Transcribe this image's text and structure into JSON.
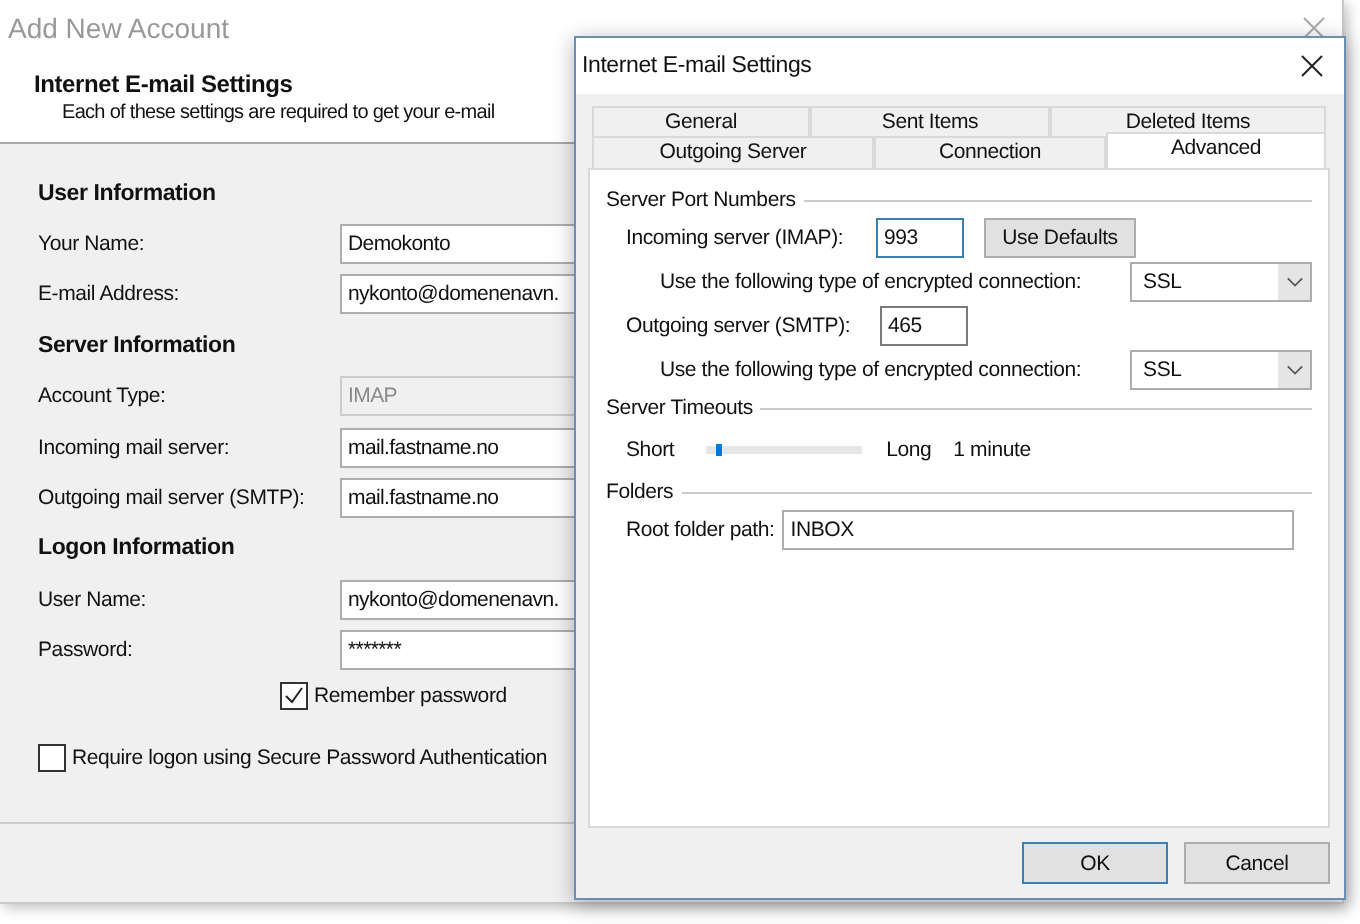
{
  "background_dialog": {
    "title": "Add New Account",
    "heading": "Internet E-mail Settings",
    "subtitle": "Each of these settings are required to get your e-mail",
    "sections": [
      {
        "title": "User Information",
        "fields": [
          {
            "label": "Your Name:",
            "value": "Demokonto",
            "disabled": false
          },
          {
            "label": "E-mail Address:",
            "value": "nykonto@domenenavn.",
            "disabled": false
          }
        ]
      },
      {
        "title": "Server Information",
        "fields": [
          {
            "label": "Account Type:",
            "value": "IMAP",
            "disabled": true
          },
          {
            "label": "Incoming mail server:",
            "value": "mail.fastname.no",
            "disabled": false
          },
          {
            "label": "Outgoing mail server (SMTP):",
            "value": "mail.fastname.no",
            "disabled": false
          }
        ]
      },
      {
        "title": "Logon Information",
        "fields": [
          {
            "label": "User Name:",
            "value": "nykonto@domenenavn.",
            "disabled": false
          },
          {
            "label": "Password:",
            "value": "*******",
            "disabled": false
          }
        ]
      }
    ],
    "remember_password": {
      "label": "Remember password",
      "checked": true
    },
    "require_spa": {
      "label": "Require logon using Secure Password Authentication",
      "checked": false
    }
  },
  "dialog": {
    "title": "Internet E-mail Settings",
    "tab_rows": [
      [
        {
          "label": "General",
          "selected": false
        },
        {
          "label": "Sent Items",
          "selected": false
        },
        {
          "label": "Deleted Items",
          "selected": false
        }
      ],
      [
        {
          "label": "Outgoing Server",
          "selected": false
        },
        {
          "label": "Connection",
          "selected": false
        },
        {
          "label": "Advanced",
          "selected": true
        }
      ]
    ],
    "server_ports": {
      "title": "Server Port Numbers",
      "incoming_label": "Incoming server (IMAP):",
      "incoming_port": "993",
      "use_defaults": "Use Defaults",
      "incoming_encryption_label": "Use the following type of encrypted connection:",
      "incoming_encryption": "SSL",
      "outgoing_label": "Outgoing server (SMTP):",
      "outgoing_port": "465",
      "outgoing_encryption_label": "Use the following type of encrypted connection:",
      "outgoing_encryption": "SSL"
    },
    "timeouts": {
      "title": "Server Timeouts",
      "short_label": "Short",
      "level": 0.08,
      "long_label": "Long",
      "value": "1 minute"
    },
    "folders": {
      "title": "Folders",
      "root_label": "Root folder path:",
      "root_value": "INBOX"
    },
    "buttons": [
      "OK",
      "Cancel"
    ]
  }
}
